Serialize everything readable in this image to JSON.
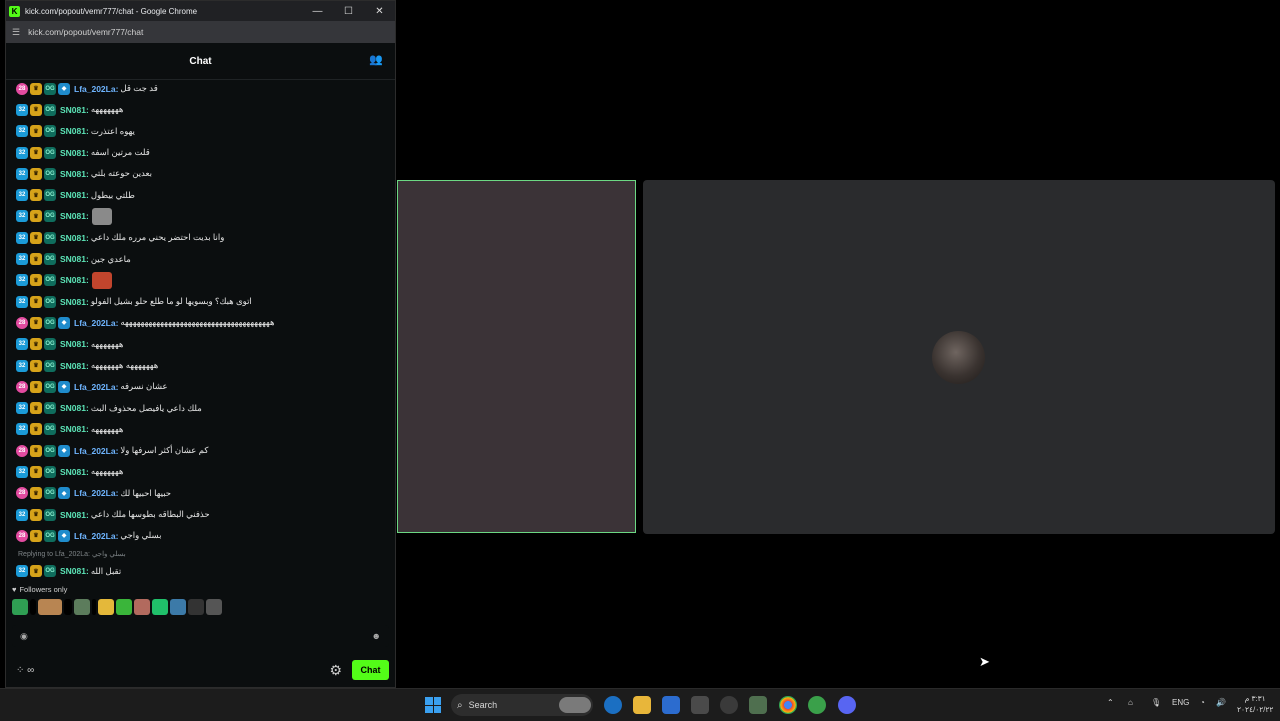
{
  "window": {
    "title": "kick.com/popout/vemr777/chat - Google Chrome",
    "url": "kick.com/popout/vemr777/chat",
    "minimize": "—",
    "maximize": "☐",
    "close": "✕"
  },
  "chat": {
    "header_title": "Chat",
    "messages": [
      {
        "user": "Lfa_202La:",
        "text": "قد جت قل"
      },
      {
        "user": "SN081:",
        "text": "هههههههه"
      },
      {
        "user": "SN081:",
        "text": "يهوه اعتذرت"
      },
      {
        "user": "SN081:",
        "text": "قلت مرتين اسفه"
      },
      {
        "user": "SN081:",
        "text": "بعدين حوعته بلتي"
      },
      {
        "user": "SN081:",
        "text": "طلتي بيطول"
      },
      {
        "user": "SN081:",
        "text": ""
      },
      {
        "user": "SN081:",
        "text": "وانا بديت احتضر يحني مرره ملك داعي"
      },
      {
        "user": "SN081:",
        "text": "ماعدي جين"
      },
      {
        "user": "SN081:",
        "text": ""
      },
      {
        "user": "SN081:",
        "text": "اتوی هبك؟ وبسويها لو ما طلع حلو بشيل الفولو"
      },
      {
        "user": "Lfa_202La:",
        "text": "ههههههههههههههههههههههههههههههههههههههه"
      },
      {
        "user": "SN081:",
        "text": "هههههههه"
      },
      {
        "user": "SN081:",
        "text": "هههههههه هههههههه"
      },
      {
        "user": "Lfa_202La:",
        "text": "عشان نسرفه"
      },
      {
        "user": "SN081:",
        "text": "ملك داعي يافيصل محذوف البث"
      },
      {
        "user": "SN081:",
        "text": "هههههههه"
      },
      {
        "user": "Lfa_202La:",
        "text": "كم عشان أكثر اسرفها ولا"
      },
      {
        "user": "SN081:",
        "text": "هههههههه"
      },
      {
        "user": "Lfa_202La:",
        "text": "حبيها احبيها لك"
      },
      {
        "user": "SN081:",
        "text": "حذفني البطاقه بطوسها ملك داعي"
      },
      {
        "user": "Lfa_202La:",
        "text": "بسلي واجي"
      }
    ],
    "reply_to": "Replying to Lfa_202La: بسلي واجي",
    "last_message": {
      "user": "SN081:",
      "text": "تقبل الله"
    },
    "followers_only": "Followers only",
    "send_button": "Chat"
  },
  "taskbar": {
    "search_label": "Search",
    "language": "ENG",
    "time": "٣:٣١ م",
    "date": "٢٠٢٤/٠٢/٢٢"
  },
  "colors": {
    "accent": "#53fc18",
    "sn_username": "#5ce4b7",
    "lfa_username": "#6fb5ff",
    "tile_border": "#6cd883"
  },
  "icons": [
    "kick-logo-icon",
    "site-info-icon",
    "user-manage-icon",
    "crown-badge-icon",
    "og-badge-icon",
    "vip-badge-icon",
    "subscriber-badge-icon",
    "heart-icon",
    "emoji-icon",
    "settings-gear-icon",
    "infinity-icon",
    "windows-start-icon",
    "search-icon",
    "edge-icon",
    "file-explorer-icon",
    "store-icon",
    "chrome-icon",
    "discord-icon"
  ]
}
